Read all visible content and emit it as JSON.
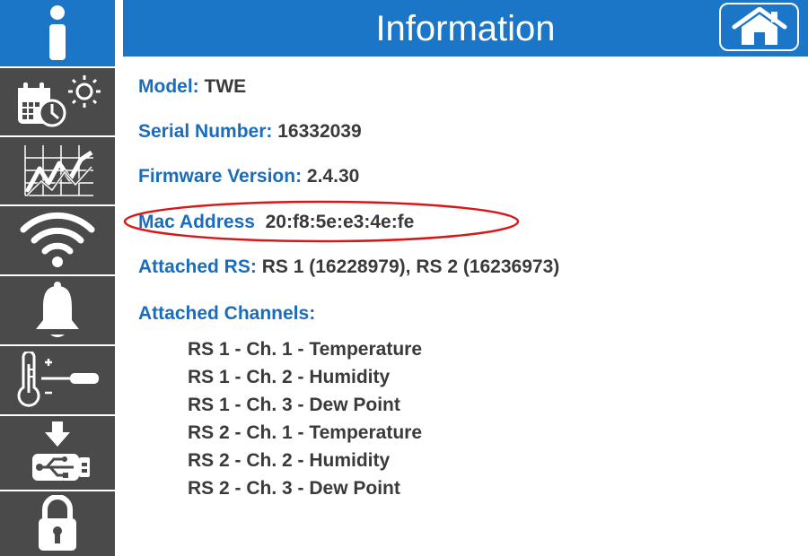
{
  "header": {
    "title": "Information"
  },
  "sidebar": {
    "items": [
      {
        "icon": "info-icon",
        "active": true
      },
      {
        "icon": "schedule-icon",
        "active": false
      },
      {
        "icon": "graph-icon",
        "active": false
      },
      {
        "icon": "wifi-icon",
        "active": false
      },
      {
        "icon": "bell-icon",
        "active": false
      },
      {
        "icon": "calibration-icon",
        "active": false
      },
      {
        "icon": "usb-download-icon",
        "active": false
      },
      {
        "icon": "lock-icon",
        "active": false
      }
    ]
  },
  "info": {
    "model": {
      "label": "Model:",
      "value": "TWE"
    },
    "serial": {
      "label": "Serial Number:",
      "value": "16332039"
    },
    "firmware": {
      "label": "Firmware Version:",
      "value": "2.4.30"
    },
    "mac": {
      "label": "Mac Address",
      "value": "20:f8:5e:e3:4e:fe"
    },
    "attached_rs": {
      "label": "Attached RS:",
      "value": "RS 1 (16228979), RS 2 (16236973)"
    },
    "attached_channels": {
      "label": "Attached Channels:",
      "items": [
        "RS 1 - Ch. 1 - Temperature",
        "RS 1 - Ch. 2 - Humidity",
        "RS 1 - Ch. 3 - Dew Point",
        "RS 2 - Ch. 1 - Temperature",
        "RS 2 - Ch. 2 - Humidity",
        "RS 2 - Ch. 3 - Dew Point"
      ]
    }
  },
  "colors": {
    "accent": "#1b76c8",
    "sidebar": "#4a4a4a",
    "label": "#1b6dbb",
    "text": "#3a3a3a",
    "highlight_ellipse": "#d81818"
  }
}
